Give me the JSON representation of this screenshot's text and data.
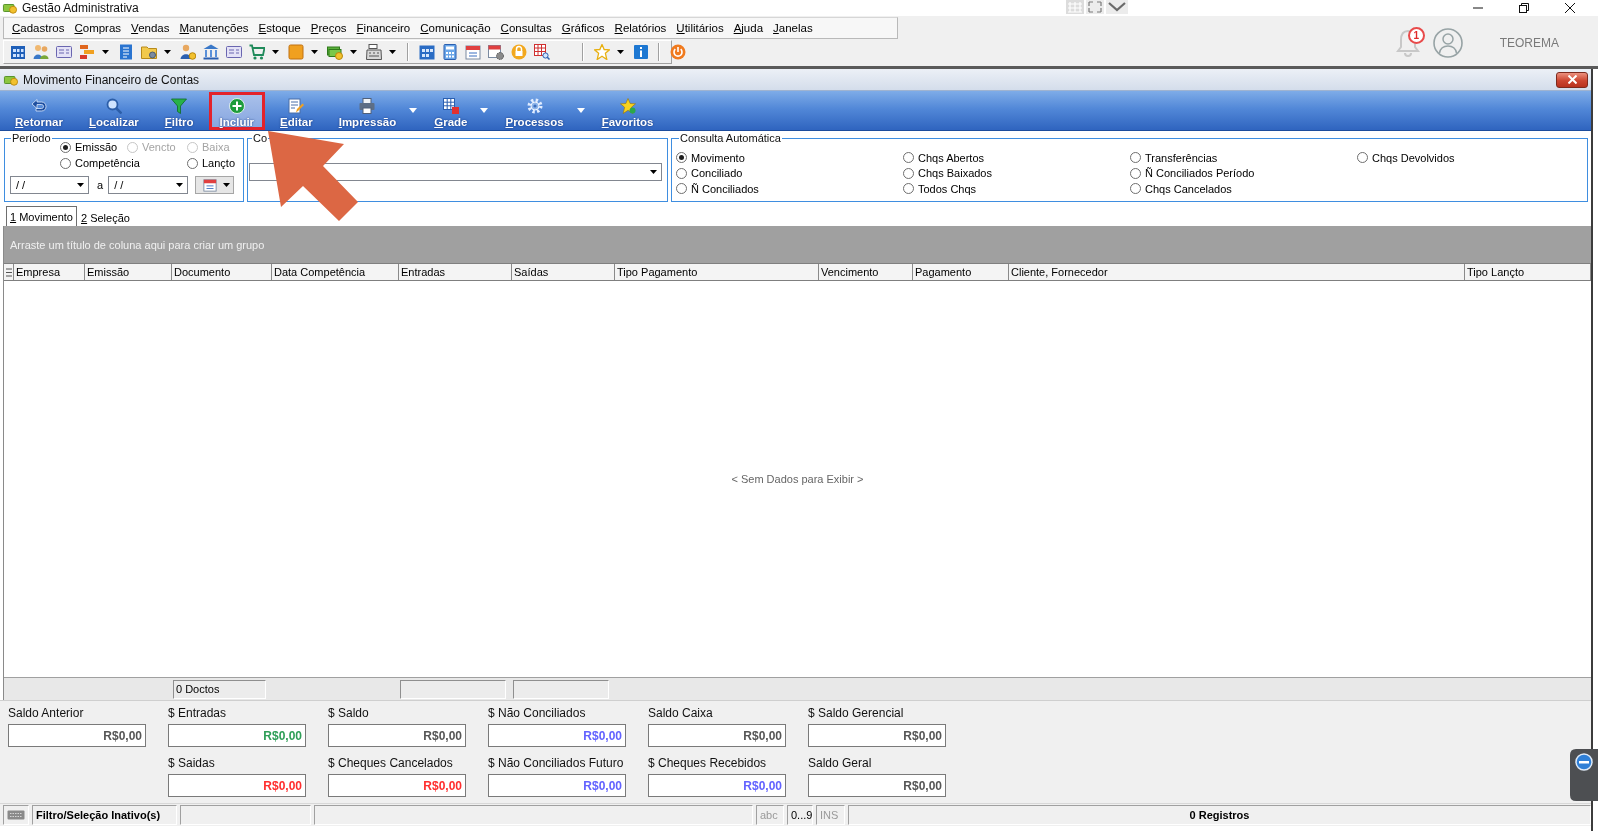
{
  "app_window": {
    "title": "Gestão Administrativa"
  },
  "menu": [
    "Cadastros",
    "Compras",
    "Vendas",
    "Manutenções",
    "Estoque",
    "Preços",
    "Financeiro",
    "Comunicação",
    "Consultas",
    "Gráficos",
    "Relatórios",
    "Utilitários",
    "Ajuda",
    "Janelas"
  ],
  "user_area": {
    "notification_count": "1",
    "user_name": "TEOREMA"
  },
  "form": {
    "title": "Movimento Financeiro de Contas"
  },
  "ribbon": [
    {
      "label": "Retornar",
      "dropdown": false,
      "highlighted": false
    },
    {
      "label": "Localizar",
      "dropdown": false,
      "highlighted": false
    },
    {
      "label": "Filtro",
      "dropdown": false,
      "highlighted": false
    },
    {
      "label": "Incluir",
      "dropdown": false,
      "highlighted": true
    },
    {
      "label": "Editar",
      "dropdown": false,
      "highlighted": false
    },
    {
      "label": "Impressão",
      "dropdown": true,
      "highlighted": false
    },
    {
      "label": "Grade",
      "dropdown": true,
      "highlighted": false
    },
    {
      "label": "Processos",
      "dropdown": true,
      "highlighted": false
    },
    {
      "label": "Favoritos",
      "dropdown": false,
      "highlighted": false
    }
  ],
  "annotations": [
    {
      "kind": "arrow"
    }
  ],
  "period": {
    "label": "Período",
    "options": [
      {
        "label": "Emissão",
        "selected": true,
        "disabled": false
      },
      {
        "label": "Vencto",
        "selected": false,
        "disabled": true
      },
      {
        "label": "Baixa",
        "selected": false,
        "disabled": true
      },
      {
        "label": "Competência",
        "selected": false,
        "disabled": false
      },
      {
        "label": "Lançto",
        "selected": false,
        "disabled": false
      }
    ],
    "date_from": "/ /",
    "range_separator": "a",
    "date_to": "/ /"
  },
  "group_2": {
    "label": "Co"
  },
  "auto_query": {
    "label": "Consulta Automática",
    "options": [
      {
        "label": "Movimento",
        "selected": true
      },
      {
        "label": "Conciliado",
        "selected": false
      },
      {
        "label": "Ñ Conciliados",
        "selected": false
      },
      {
        "label": "Chqs Abertos",
        "selected": false
      },
      {
        "label": "Chqs Baixados",
        "selected": false
      },
      {
        "label": "Todos Chqs",
        "selected": false
      },
      {
        "label": "Transferências",
        "selected": false
      },
      {
        "label": "Ñ Conciliados Período",
        "selected": false
      },
      {
        "label": "Chqs Cancelados",
        "selected": false
      },
      {
        "label": "Chqs Devolvidos",
        "selected": false
      }
    ]
  },
  "tabs": [
    {
      "label": "1 Movimento",
      "selected": true
    },
    {
      "label": "2 Seleção",
      "selected": false
    }
  ],
  "grid": {
    "group_hint": "Arraste um título de coluna aqui para criar um grupo",
    "columns": [
      {
        "label": "Empresa",
        "summary": false
      },
      {
        "label": "Emissão",
        "summary": false
      },
      {
        "label": "Documento",
        "summary": true,
        "summary_text": "0 Doctos"
      },
      {
        "label": "Data Competência",
        "summary": false
      },
      {
        "label": "Entradas",
        "summary": true
      },
      {
        "label": "Saídas",
        "summary": true
      },
      {
        "label": "Tipo Pagamento",
        "summary": false
      },
      {
        "label": "Vencimento",
        "summary": false
      },
      {
        "label": "Pagamento",
        "summary": false
      },
      {
        "label": "Cliente, Fornecedor",
        "summary": false
      },
      {
        "label": "Tipo Lançto",
        "summary": false
      }
    ],
    "empty_message": "< Sem Dados para Exibir >"
  },
  "totals": [
    {
      "items": [
        {
          "label": "Saldo Anterior",
          "value": "R$0,00",
          "color": "#555555"
        },
        {
          "label": "$ Entradas",
          "value": "R$0,00",
          "color": "#2e9e57"
        },
        {
          "label": "$ Saldo",
          "value": "R$0,00",
          "color": "#555555"
        },
        {
          "label": "$ Não Conciliados",
          "value": "R$0,00",
          "color": "#6262ff"
        },
        {
          "label": "Saldo Caixa",
          "value": "R$0,00",
          "color": "#555555"
        },
        {
          "label": "$ Saldo Gerencial",
          "value": "R$0,00",
          "color": "#555555"
        }
      ]
    },
    {
      "items": [
        {
          "label": "$ Saidas",
          "value": "R$0,00",
          "color": "#ff2e2e"
        },
        {
          "label": "$ Cheques Cancelados",
          "value": "R$0,00",
          "color": "#ff2e2e"
        },
        {
          "label": "$ Não Conciliados Futuro",
          "value": "R$0,00",
          "color": "#6262ff"
        },
        {
          "label": "$ Cheques Recebidos",
          "value": "R$0,00",
          "color": "#6262ff"
        },
        {
          "label": "Saldo Geral",
          "value": "R$0,00",
          "color": "#555555"
        }
      ]
    }
  ],
  "status_bar": {
    "filter_state": "Filtro/Seleção Inativo(s)",
    "indicators": [
      {
        "label": "abc",
        "on": false
      },
      {
        "label": "0...9",
        "on": true
      },
      {
        "label": "INS",
        "on": false
      }
    ],
    "records": "0 Registros"
  }
}
